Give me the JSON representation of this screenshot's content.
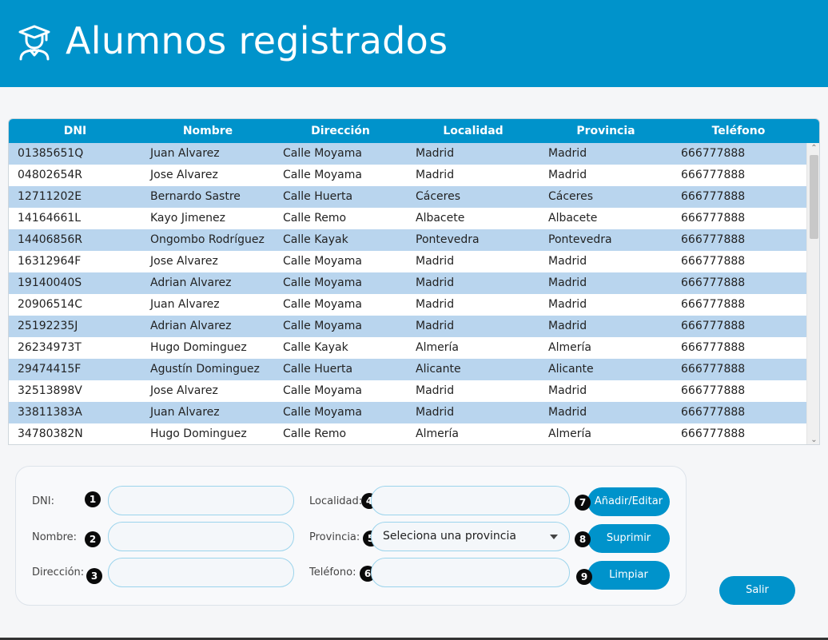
{
  "header": {
    "title": "Alumnos registrados",
    "icon": "student-graduation-icon"
  },
  "table": {
    "columns": [
      "DNI",
      "Nombre",
      "Dirección",
      "Localidad",
      "Provincia",
      "Teléfono"
    ],
    "rows": [
      [
        "01385651Q",
        "Juan Alvarez",
        "Calle Moyama",
        "Madrid",
        "Madrid",
        "666777888"
      ],
      [
        "04802654R",
        "Jose Alvarez",
        "Calle Moyama",
        "Madrid",
        "Madrid",
        "666777888"
      ],
      [
        "12711202E",
        "Bernardo Sastre",
        "Calle Huerta",
        "Cáceres",
        "Cáceres",
        "666777888"
      ],
      [
        "14164661L",
        "Kayo Jimenez",
        "Calle Remo",
        "Albacete",
        "Albacete",
        "666777888"
      ],
      [
        "14406856R",
        "Ongombo Rodríguez",
        "Calle Kayak",
        "Pontevedra",
        "Pontevedra",
        "666777888"
      ],
      [
        "16312964F",
        "Jose Alvarez",
        "Calle Moyama",
        "Madrid",
        "Madrid",
        "666777888"
      ],
      [
        "19140040S",
        "Adrian Alvarez",
        "Calle Moyama",
        "Madrid",
        "Madrid",
        "666777888"
      ],
      [
        "20906514C",
        "Juan Alvarez",
        "Calle Moyama",
        "Madrid",
        "Madrid",
        "666777888"
      ],
      [
        "25192235J",
        "Adrian Alvarez",
        "Calle Moyama",
        "Madrid",
        "Madrid",
        "666777888"
      ],
      [
        "26234973T",
        "Hugo Dominguez",
        "Calle Kayak",
        "Almería",
        "Almería",
        "666777888"
      ],
      [
        "29474415F",
        "Agustín Dominguez",
        "Calle Huerta",
        "Alicante",
        "Alicante",
        "666777888"
      ],
      [
        "32513898V",
        "Jose Alvarez",
        "Calle Moyama",
        "Madrid",
        "Madrid",
        "666777888"
      ],
      [
        "33811383A",
        "Juan Alvarez",
        "Calle Moyama",
        "Madrid",
        "Madrid",
        "666777888"
      ],
      [
        "34780382N",
        "Hugo Dominguez",
        "Calle Remo",
        "Almería",
        "Almería",
        "666777888"
      ]
    ]
  },
  "form": {
    "dni_label": "DNI:",
    "nombre_label": "Nombre:",
    "direccion_label": "Dirección:",
    "localidad_label": "Localidad:",
    "provincia_label": "Provincia:",
    "telefono_label": "Teléfono:",
    "dni_value": "",
    "nombre_value": "",
    "direccion_value": "",
    "localidad_value": "",
    "telefono_value": "",
    "provincia_selected": "Seleciona una provincia",
    "markers": [
      "1",
      "2",
      "3",
      "4",
      "5",
      "6",
      "7",
      "8",
      "9"
    ]
  },
  "buttons": {
    "add_edit": "Añadir/Editar",
    "delete": "Suprimir",
    "clear": "Limpiar",
    "exit": "Salir"
  },
  "colors": {
    "accent": "#0093cb",
    "row_alt": "#b9d5ee",
    "field_border": "#9cd4ec"
  }
}
